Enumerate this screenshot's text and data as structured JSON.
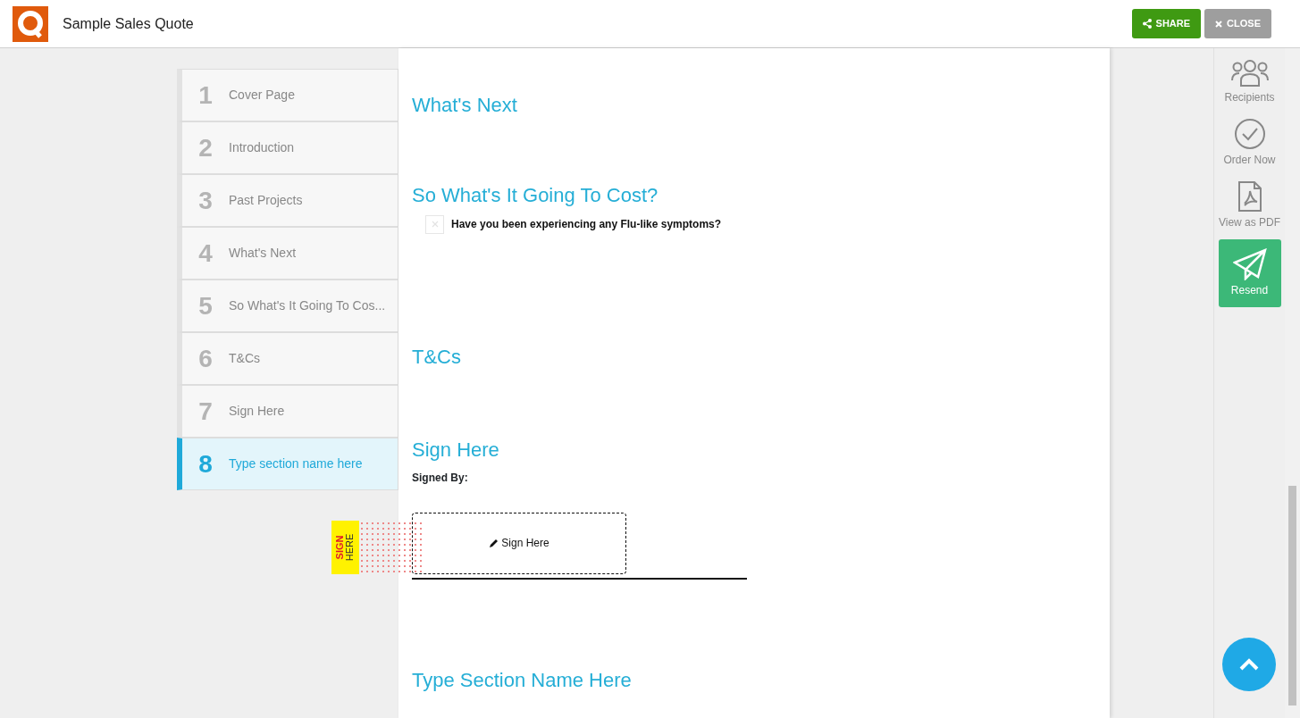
{
  "header": {
    "title": "Sample Sales Quote",
    "buttons": [
      {
        "kind": "share",
        "label": "SHARE"
      },
      {
        "kind": "close",
        "label": "CLOSE"
      }
    ]
  },
  "sections_nav": [
    {
      "number": "1",
      "label": "Cover Page",
      "selected": false
    },
    {
      "number": "2",
      "label": "Introduction",
      "selected": false
    },
    {
      "number": "3",
      "label": "Past Projects",
      "selected": false
    },
    {
      "number": "4",
      "label": "What's Next",
      "selected": false
    },
    {
      "number": "5",
      "label": "So What's It Going To Cos...",
      "selected": false
    },
    {
      "number": "6",
      "label": "T&Cs",
      "selected": false
    },
    {
      "number": "7",
      "label": "Sign Here",
      "selected": false
    },
    {
      "number": "8",
      "label": "Type section name here",
      "selected": true
    }
  ],
  "document": {
    "sections": [
      {
        "kind": "heading",
        "title": "What's Next"
      },
      {
        "kind": "question",
        "title": "So What's It Going To Cost?",
        "question": "Have you been experiencing any Flu-like symptoms?",
        "checked": false
      },
      {
        "kind": "heading",
        "title": "T&Cs"
      },
      {
        "kind": "signature",
        "title": "Sign Here",
        "signed_by_label": "Signed By:",
        "sign_button": "Sign Here",
        "tag_top": "SIGN",
        "tag_bottom": "HERE"
      },
      {
        "kind": "heading",
        "title": "Type Section Name Here"
      }
    ]
  },
  "actions": [
    {
      "kind": "recipients",
      "label": "Recipients"
    },
    {
      "kind": "order",
      "label": "Order Now"
    },
    {
      "kind": "pdf",
      "label": "View as PDF"
    },
    {
      "kind": "resend",
      "label": "Resend"
    }
  ]
}
